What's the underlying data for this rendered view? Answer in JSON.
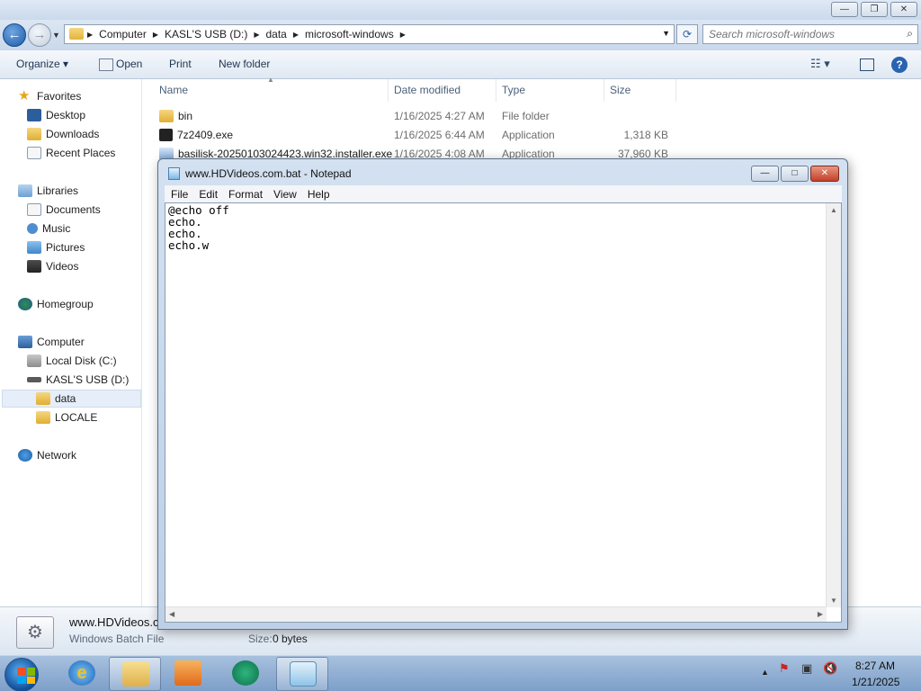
{
  "explorer": {
    "window_buttons": [
      "—",
      "❐",
      "✕"
    ],
    "address": {
      "crumbs": [
        "Computer",
        "KASL'S USB (D:)",
        "data",
        "microsoft-windows"
      ]
    },
    "search": {
      "placeholder": "Search microsoft-windows"
    },
    "toolbar": {
      "organize": "Organize ▾",
      "open": "Open",
      "print": "Print",
      "new_folder": "New folder"
    },
    "nav": {
      "favorites": "Favorites",
      "desktop": "Desktop",
      "downloads": "Downloads",
      "recent_places": "Recent Places",
      "libraries": "Libraries",
      "documents": "Documents",
      "music": "Music",
      "pictures": "Pictures",
      "videos": "Videos",
      "homegroup": "Homegroup",
      "computer": "Computer",
      "local_disk": "Local Disk (C:)",
      "usb": "KASL'S USB (D:)",
      "data": "data",
      "locale": "LOCALE",
      "network": "Network"
    },
    "columns": {
      "name": "Name",
      "date": "Date modified",
      "type": "Type",
      "size": "Size"
    },
    "files": [
      {
        "name": "bin",
        "date": "1/16/2025 4:27 AM",
        "type": "File folder",
        "size": ""
      },
      {
        "name": "7z2409.exe",
        "date": "1/16/2025 6:44 AM",
        "type": "Application",
        "size": "1,318 KB"
      },
      {
        "name": "basilisk-20250103024423.win32.installer.exe",
        "date": "1/16/2025 4:08 AM",
        "type": "Application",
        "size": "37,960 KB"
      }
    ],
    "details": {
      "name": "www.HDVideos.c",
      "type": "Windows Batch File",
      "size_label": "Size:",
      "size_value": "0 bytes"
    }
  },
  "notepad": {
    "title": "www.HDVideos.com.bat - Notepad",
    "menu": [
      "File",
      "Edit",
      "Format",
      "View",
      "Help"
    ],
    "content": "@echo off\necho.\necho.\necho.w"
  },
  "taskbar": {
    "time": "8:27 AM",
    "date": "1/21/2025"
  }
}
